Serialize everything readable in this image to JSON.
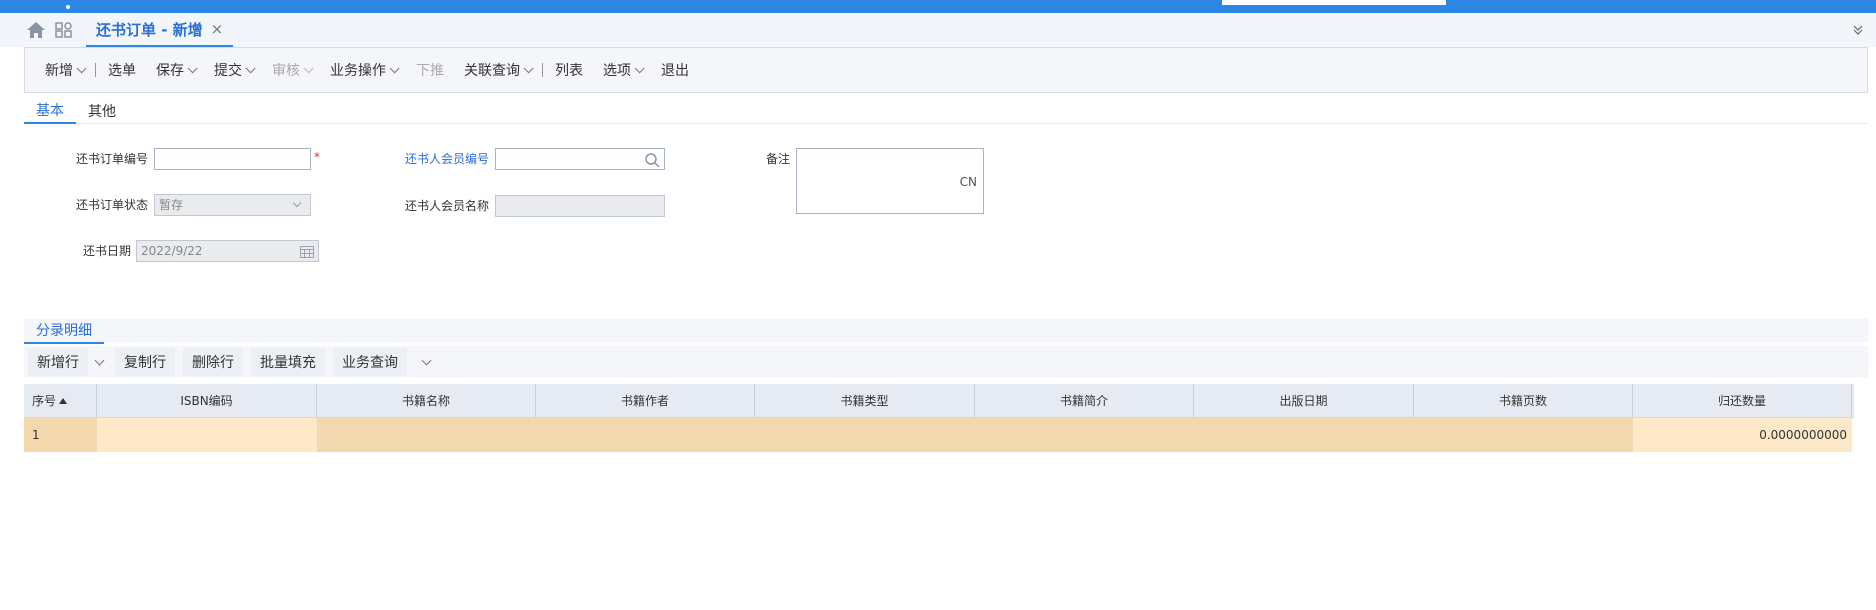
{
  "colors": {
    "accent": "#2b86e4",
    "link": "#2b6fd6",
    "required": "#e03030",
    "row_tan": "#f2d8af",
    "row_light": "#fde9c7"
  },
  "tab": {
    "title": "还书订单 - 新增",
    "close": "×"
  },
  "toolbar": {
    "items": [
      {
        "label": "新增",
        "caret": true,
        "sep": true
      },
      {
        "label": "选单"
      },
      {
        "label": "保存",
        "caret": true
      },
      {
        "label": "提交",
        "caret": true
      },
      {
        "label": "审核",
        "caret": true,
        "disabled": true
      },
      {
        "label": "业务操作",
        "caret": true
      },
      {
        "label": "下推",
        "disabled": true
      },
      {
        "label": "关联查询",
        "caret": true,
        "sep": true
      },
      {
        "label": "列表"
      },
      {
        "label": "选项",
        "caret": true
      },
      {
        "label": "退出"
      }
    ]
  },
  "subtabs": [
    "基本",
    "其他"
  ],
  "form": {
    "order_no_label": "还书订单编号",
    "order_no_value": "",
    "required_mark": "*",
    "status_label": "还书订单状态",
    "status_value": "暂存",
    "date_label": "还书日期",
    "date_value": "2022/9/22",
    "member_no_label": "还书人会员编号",
    "member_no_value": "",
    "member_name_label": "还书人会员名称",
    "member_name_value": "",
    "memo_label": "备注",
    "memo_lang": "CN"
  },
  "entry": {
    "tab_label": "分录明细",
    "toolbar": [
      "新增行",
      "复制行",
      "删除行",
      "批量填充",
      "业务查询"
    ],
    "columns": [
      "序号",
      "ISBN编码",
      "书籍名称",
      "书籍作者",
      "书籍类型",
      "书籍简介",
      "出版日期",
      "书籍页数",
      "归还数量"
    ],
    "rows": [
      [
        "1",
        "",
        "",
        "",
        "",
        "",
        "",
        "",
        "0.0000000000"
      ]
    ]
  }
}
